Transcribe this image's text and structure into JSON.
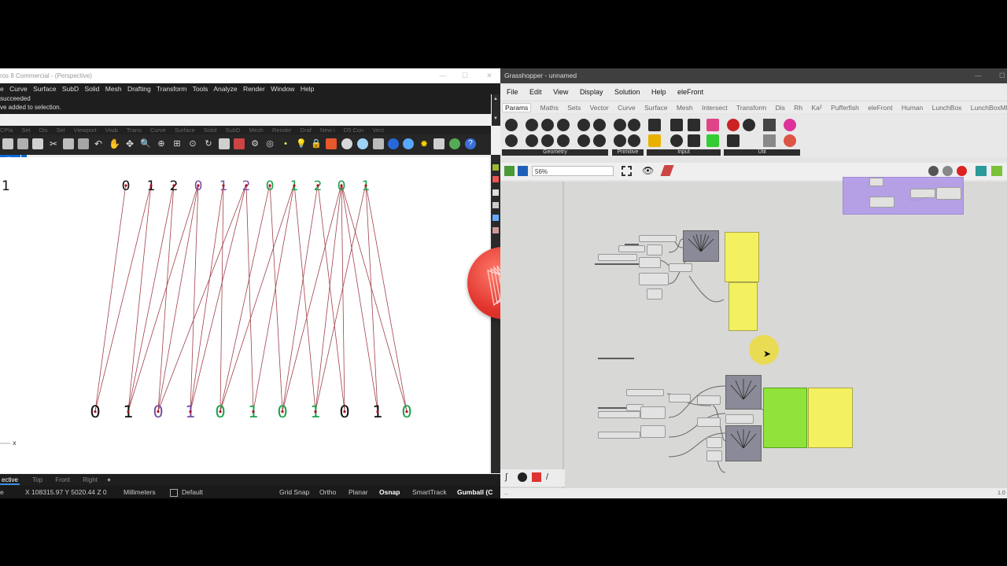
{
  "rhino": {
    "title": "ros 8 Commercial - (Perspective)",
    "menu": [
      "e",
      "Curve",
      "Surface",
      "SubD",
      "Solid",
      "Mesh",
      "Drafting",
      "Transform",
      "Tools",
      "Analyze",
      "Render",
      "Window",
      "Help"
    ],
    "command_history": [
      "succeeded",
      "ve added to selection.",
      ":"
    ],
    "toolbar_tabs": [
      "CPla",
      "Set",
      "Dis",
      "Sel",
      "Viewport",
      "Visib",
      "Trans",
      "Curve",
      "Surface",
      "Solid",
      "SubD",
      "Mesh",
      "Render",
      "Draf",
      "New i",
      "D5 Con",
      "Vect"
    ],
    "viewport_label": "ective",
    "top_digits": [
      "0",
      "1",
      "2",
      "0",
      "1",
      "2",
      "0",
      "1",
      "2",
      "0",
      "1"
    ],
    "bottom_digits": [
      "0",
      "1",
      "0",
      "1",
      "0",
      "1",
      "0",
      "1",
      "0",
      "1",
      "0"
    ],
    "left_partial_digit": "1",
    "axis_label": "x",
    "viewport_tabs": [
      "ective",
      "Top",
      "Front",
      "Right"
    ],
    "add_viewport": "+",
    "status": {
      "left": "e",
      "coords": "X 108315.97 Y 5020.44 Z 0",
      "units": "Millimeters",
      "layer": "Default",
      "grid_snap": "Grid Snap",
      "ortho": "Ortho",
      "planar": "Planar",
      "osnap": "Osnap",
      "smarttrack": "SmartTrack",
      "gumball": "Gumball (C"
    },
    "colors": {
      "digit_dark": "#111111",
      "digit_purple": "#7a4fa3",
      "digit_green": "#1aa34a",
      "line": "#a0404a"
    }
  },
  "grasshopper": {
    "title": "Grasshopper - unnamed",
    "menu": [
      "File",
      "Edit",
      "View",
      "Display",
      "Solution",
      "Help",
      "eleFront"
    ],
    "tabs": [
      "Params",
      "Maths",
      "Sets",
      "Vector",
      "Curve",
      "Surface",
      "Mesh",
      "Intersect",
      "Transform",
      "Dis",
      "Rh",
      "Ka²",
      "Pufferfish",
      "eleFront",
      "Human",
      "LunchBox",
      "LunchBoxML"
    ],
    "ribbon_groups": [
      "Geometry",
      "Primitive",
      "Input",
      "Util"
    ],
    "zoom": "56%",
    "status_right": "1.0",
    "status_left": "..."
  }
}
